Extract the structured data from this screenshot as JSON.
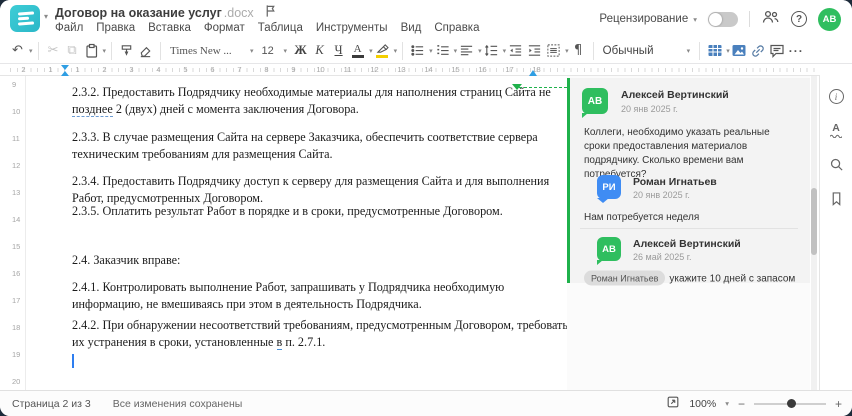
{
  "colors": {
    "brand_teal": "#2ebfcb",
    "accent_green": "#1fb14b",
    "avatar_green": "#2fbe5f",
    "avatar_blue": "#3f8cf3",
    "marker_blue": "#2f9ee3",
    "toolbar_icon_blue": "#4a80bd"
  },
  "header": {
    "title": "Договор на оказание услуг",
    "title_ext": ".docx",
    "menu": [
      "Файл",
      "Правка",
      "Вставка",
      "Формат",
      "Таблица",
      "Инструменты",
      "Вид",
      "Справка"
    ],
    "review_label": "Рецензирование",
    "avatar_initials": "АВ"
  },
  "toolbar": {
    "font_name": "Times New ...",
    "font_size": "12",
    "bold": "Ж",
    "italic": "К",
    "underline": "Ч",
    "font_color_letter": "А",
    "style_name": "Обычный"
  },
  "icons": {
    "caret": "▾",
    "undo": "↶",
    "cut": "✂",
    "copy": "⧉",
    "pilcrow": "¶",
    "more": "···",
    "flag": "⚐",
    "minus": "−",
    "plus": "+",
    "question": "?",
    "info": "i"
  },
  "ruler": {
    "h": [
      "2",
      "1",
      "1",
      "2",
      "3",
      "4",
      "5",
      "6",
      "7",
      "8",
      "9",
      "10",
      "11",
      "12",
      "13",
      "14",
      "15",
      "16",
      "17",
      "18"
    ],
    "v": [
      "9",
      "10",
      "11",
      "12",
      "13",
      "14",
      "15",
      "16",
      "17",
      "18",
      "19",
      "20"
    ]
  },
  "document": {
    "p1_l1": "2.3.2. Предоставить Подрядчику необходимые материалы для наполнения страниц Сайта не",
    "p1_l2_marked": "позднее",
    "p1_l2_rest": " 2 (двух) дней с момента заключения Договора.",
    "p2_l1": "2.3.3. В случае размещения Сайта на сервере Заказчика, обеспечить соответствие сервера",
    "p2_l2": "техническим требованиям для размещения Сайта.",
    "p3_l1": "2.3.4. Предоставить Подрядчику доступ к серверу для размещения Сайта и для выполнения",
    "p3_l2": "Работ, предусмотренных Договором.",
    "p4": "2.3.5. Оплатить результат Работ в порядке и в сроки, предусмотренные Договором.",
    "p5": "2.4. Заказчик вправе:",
    "p6_l1": "2.4.1. Контролировать выполнение Работ, запрашивать у Подрядчика необходимую",
    "p6_l2": "информацию, не вмешиваясь при этом в деятельность Подрядчика.",
    "p7_l1": "2.4.2. При обнаружении несоответствий требованиям, предусмотренным Договором, требовать",
    "p7_l2_a": "их устранения в сроки, установленные ",
    "p7_l2_marked": "в",
    "p7_l2_b": " п. 2.7.1."
  },
  "comments": {
    "main": {
      "initials": "АВ",
      "name": "Алексей Вертинский",
      "date": "20 янв 2025 г.",
      "body": "Коллеги, необходимо указать реальные сроки предоставления материалов подрядчику. Сколько времени вам потребуется?"
    },
    "reply1": {
      "initials": "РИ",
      "name": "Роман Игнатьев",
      "date": "20 янв 2025 г.",
      "body": "Нам потребуется неделя"
    },
    "reply2": {
      "initials": "АВ",
      "name": "Алексей Вертинский",
      "date": "26 май 2025 г.",
      "mention": "Роман Игнатьев",
      "body": "укажите 10 дней с запасом"
    }
  },
  "status_bar": {
    "page": "Страница 2 из 3",
    "saved": "Все изменения сохранены",
    "zoom": "100%"
  }
}
